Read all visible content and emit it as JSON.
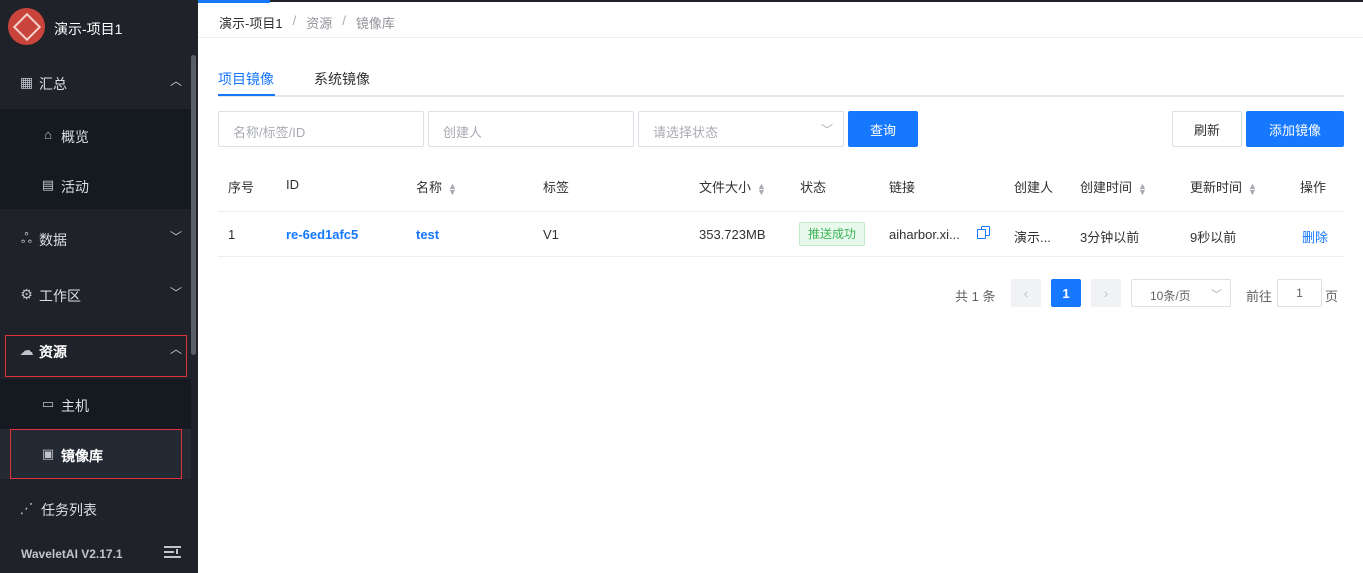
{
  "sidebar": {
    "project_name": "演示-项目1",
    "groups": {
      "summary": {
        "label": "汇总",
        "icon": "grid-icon",
        "expanded": true
      },
      "overview": {
        "label": "概览",
        "icon": "home-icon"
      },
      "activity": {
        "label": "活动",
        "icon": "id-card-icon"
      },
      "data": {
        "label": "数据",
        "icon": "sitemap-icon",
        "expanded": false
      },
      "workspace": {
        "label": "工作区",
        "icon": "gear-icon",
        "expanded": false
      },
      "resources": {
        "label": "资源",
        "icon": "cloud-icon",
        "expanded": true
      },
      "host": {
        "label": "主机",
        "icon": "server-icon"
      },
      "image_repo": {
        "label": "镜像库",
        "icon": "archive-icon",
        "active": true
      },
      "tasks": {
        "label": "任务列表",
        "icon": "share-icon"
      }
    },
    "version": "WaveletAI V2.17.1"
  },
  "breadcrumb": {
    "items": [
      "演示-项目1",
      "资源",
      "镜像库"
    ],
    "separator": "/"
  },
  "tabs": {
    "project_images": "项目镜像",
    "system_images": "系统镜像",
    "active": "项目镜像"
  },
  "filters": {
    "name_placeholder": "名称/标签/ID",
    "creator_placeholder": "创建人",
    "status_placeholder": "请选择状态",
    "search_label": "查询",
    "refresh_label": "刷新",
    "add_label": "添加镜像"
  },
  "table": {
    "headers": {
      "index": "序号",
      "id": "ID",
      "name": "名称",
      "tag": "标签",
      "size": "文件大小",
      "status": "状态",
      "link": "链接",
      "creator": "创建人",
      "created": "创建时间",
      "updated": "更新时间",
      "action": "操作"
    },
    "rows": [
      {
        "index": "1",
        "id": "re-6ed1afc5",
        "name": "test",
        "tag": "V1",
        "size": "353.723MB",
        "status": "推送成功",
        "link": "aiharbor.xi...",
        "creator": "演示...",
        "created": "3分钟以前",
        "updated": "9秒以前",
        "action": "删除"
      }
    ]
  },
  "pagination": {
    "total_text": "共 1 条",
    "current_page": "1",
    "page_size": "10条/页",
    "goto_label": "前往",
    "goto_value": "1",
    "page_unit": "页"
  },
  "colors": {
    "accent": "#1677ff",
    "sidebar_bg": "#1f2329",
    "success": "#3cb45a",
    "highlight_border": "#e0323a"
  }
}
